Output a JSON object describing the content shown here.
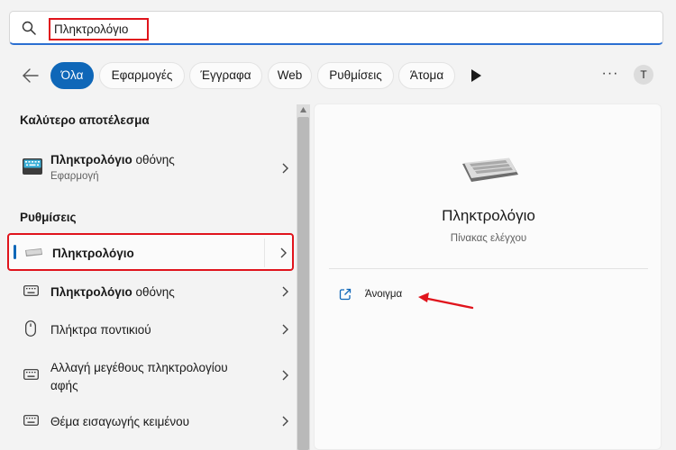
{
  "search": {
    "query": "Πληκτρολόγιο"
  },
  "filters": {
    "tabs": [
      {
        "label": "Όλα",
        "active": true
      },
      {
        "label": "Εφαρμογές"
      },
      {
        "label": "Έγγραφα"
      },
      {
        "label": "Web"
      },
      {
        "label": "Ρυθμίσεις"
      },
      {
        "label": "Άτομα"
      }
    ],
    "more_label": "···",
    "avatar_initial": "T"
  },
  "best_match": {
    "heading": "Καλύτερο αποτέλεσμα",
    "item": {
      "title_bold": "Πληκτρολόγιο",
      "title_rest": " οθόνης",
      "subtitle": "Εφαρμογή",
      "icon": "touch-keyboard-icon"
    }
  },
  "settings": {
    "heading": "Ρυθμίσεις",
    "items": [
      {
        "title_bold": "Πληκτρολόγιο",
        "title_rest": "",
        "icon": "keyboard-icon",
        "selected": true
      },
      {
        "title_bold": "Πληκτρολόγιο",
        "title_rest": " οθόνης",
        "icon": "keyboard-outline-icon"
      },
      {
        "title_bold": "",
        "title_rest": "Πλήκτρα ποντικιού",
        "icon": "mouse-icon"
      },
      {
        "title_bold": "",
        "title_rest": "Αλλαγή μεγέθους πληκτρολογίου",
        "title_line2": "αφής",
        "icon": "keyboard-outline-icon"
      },
      {
        "title_bold": "",
        "title_rest": "Θέμα εισαγωγής κειμένου",
        "icon": "keyboard-outline-icon"
      }
    ]
  },
  "detail": {
    "title": "Πληκτρολόγιο",
    "subtitle": "Πίνακας ελέγχου",
    "open_label": "Άνοιγμα",
    "icon": "keyboard-icon"
  },
  "colors": {
    "accent": "#0f67b8",
    "highlight": "#e0141c"
  }
}
